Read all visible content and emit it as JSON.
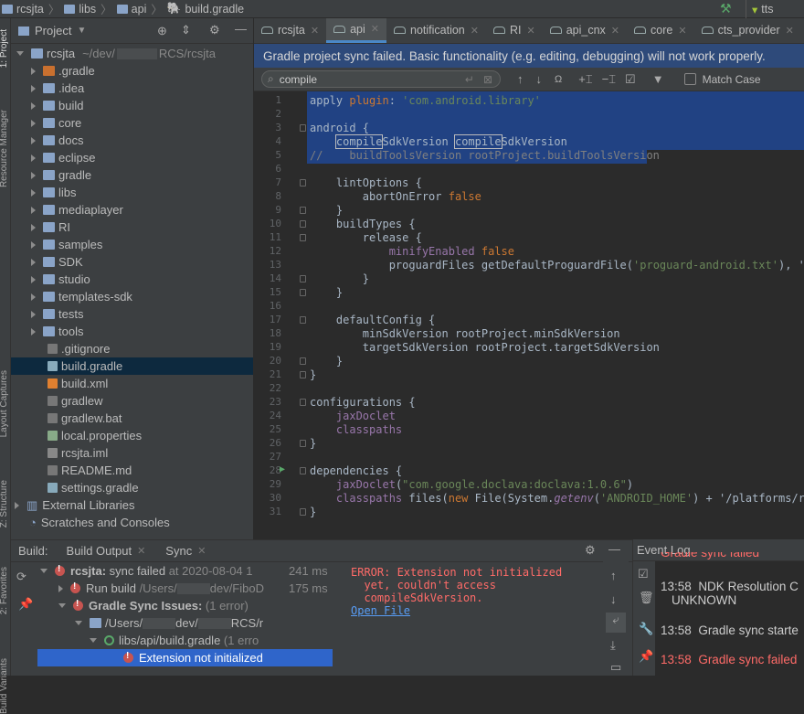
{
  "breadcrumb": [
    "rcsjta",
    "libs",
    "api",
    "build.gradle"
  ],
  "run_config": "tts",
  "side_labels": [
    "1: Project",
    "Resource Manager",
    "Layout Captures",
    "Z: Structure",
    "2: Favorites",
    "Build Variants"
  ],
  "project_panel": {
    "title": "Project",
    "root": {
      "name": "rcsjta",
      "path": "~/dev/",
      "path2": "RCS/rcsjta"
    },
    "items": [
      ".gradle",
      ".idea",
      "build",
      "core",
      "docs",
      "eclipse",
      "gradle",
      "libs",
      "mediaplayer",
      "RI",
      "samples",
      "SDK",
      "studio",
      "templates-sdk",
      "tests",
      "tools",
      ".gitignore",
      "build.gradle",
      "build.xml",
      "gradlew",
      "gradlew.bat",
      "local.properties",
      "rcsjta.iml",
      "README.md",
      "settings.gradle"
    ],
    "external": "External Libraries",
    "scratches": "Scratches and Consoles"
  },
  "tabs": [
    "rcsjta",
    "api",
    "notification",
    "RI",
    "api_cnx",
    "core",
    "cts_provider"
  ],
  "banner": "Gradle project sync failed. Basic functionality (e.g. editing, debugging) will not work properly.",
  "find": {
    "query": "compile",
    "match_case": "Match Case"
  },
  "code_lines": [
    "apply plugin: 'com.android.library'",
    "",
    "android {",
    "    compileSdkVersion compileSdkVersion",
    "//    buildToolsVersion rootProject.buildToolsVersion",
    "",
    "    lintOptions {",
    "        abortOnError false",
    "    }",
    "    buildTypes {",
    "        release {",
    "            minifyEnabled false",
    "            proguardFiles getDefaultProguardFile('proguard-android.txt'), 'pro",
    "        }",
    "    }",
    "",
    "    defaultConfig {",
    "        minSdkVersion rootProject.minSdkVersion",
    "        targetSdkVersion rootProject.targetSdkVersion",
    "    }",
    "}",
    "",
    "configurations {",
    "    jaxDoclet",
    "    classpaths",
    "}",
    "",
    "dependencies {",
    "    jaxDoclet(\"com.google.doclava:doclava:1.0.6\")",
    "    classpaths files(new File(System.getenv('ANDROID_HOME') + '/platforms/roo",
    "}"
  ],
  "build": {
    "label": "Build:",
    "tabs": [
      "Build Output",
      "Sync"
    ],
    "rows": [
      {
        "name": "rcsjta:",
        "text": "sync failed",
        "extra": "at 2020-08-04 1",
        "time": "241 ms"
      },
      {
        "name": "Run build",
        "text": "/Users/",
        "extra": "dev/FiboD",
        "time": "175 ms"
      },
      {
        "name": "Gradle Sync Issues:",
        "text": "(1 error)",
        "extra": "",
        "time": ""
      },
      {
        "name": "/Users/",
        "text": "dev/",
        "extra": "RCS/r",
        "time": ""
      },
      {
        "name": "libs/api/build.gradle",
        "text": "(1 erro",
        "extra": "",
        "time": ""
      },
      {
        "name": "Extension not initialized",
        "text": "",
        "extra": "",
        "time": ""
      }
    ],
    "error": "ERROR: Extension not initialized\n  yet, couldn't access\n  compileSdkVersion.",
    "open_file": "Open File"
  },
  "event_log": {
    "title": "Event Log",
    "entries": [
      {
        "time": "13:58",
        "text": "NDK Resolution C",
        "text2": "UNKNOWN"
      },
      {
        "time": "13:58",
        "text": "Gradle sync starte",
        "text2": ""
      },
      {
        "time": "13:58",
        "text": "Gradle sync failed",
        "text2": ""
      }
    ],
    "top_cut": "Gradle sync failed"
  }
}
